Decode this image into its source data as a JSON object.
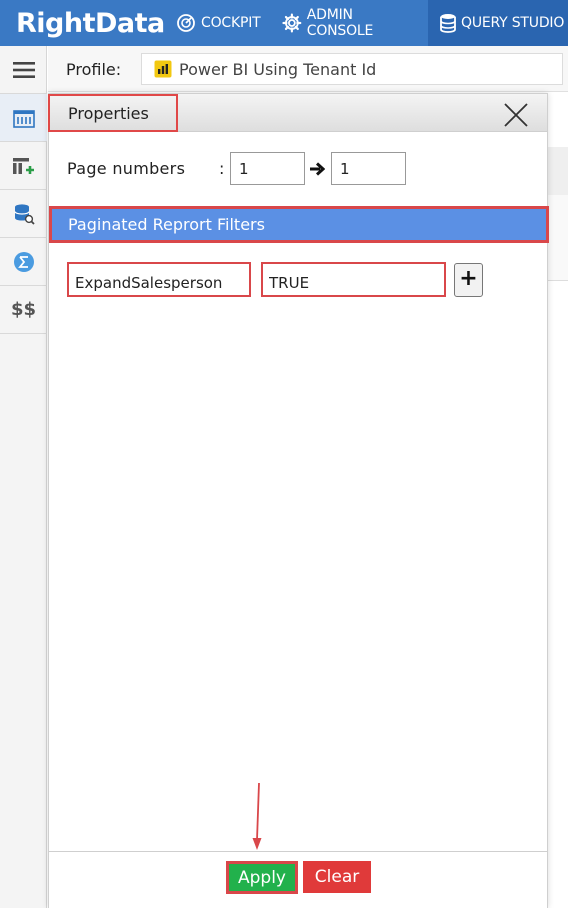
{
  "brand": {
    "logo_text": "RightData"
  },
  "nav": {
    "items": [
      {
        "label": "COCKPIT",
        "icon": "cockpit-icon"
      },
      {
        "label": "ADMIN CONSOLE",
        "icon": "gear-icon"
      },
      {
        "label": "QUERY STUDIO",
        "icon": "database-icon",
        "active": true
      }
    ]
  },
  "rail": {
    "items": [
      "menu-icon",
      "catalog-icon",
      "add-table-icon",
      "database-search-icon",
      "sigma-icon",
      "dollar-icon"
    ],
    "dollar_text": "$$"
  },
  "profile": {
    "label": "Profile:",
    "selected": "Power BI Using Tenant Id",
    "icon": "power-bi-icon"
  },
  "modal": {
    "title": "Properties",
    "page_numbers": {
      "label": "Page numbers",
      "colon": ":",
      "from": "1",
      "to": "1"
    },
    "filters_header": "Paginated Reprort Filters",
    "filters": [
      {
        "name": "ExpandSalesperson",
        "value": "TRUE"
      }
    ],
    "add_label": "+",
    "apply_label": "Apply",
    "clear_label": "Clear"
  },
  "colors": {
    "topbar": "#3a79c4",
    "topbar_active": "#2a65b0",
    "filters_band": "#5b90e4",
    "apply": "#22b14c",
    "clear": "#e03a3a",
    "highlight": "#d9474a"
  }
}
